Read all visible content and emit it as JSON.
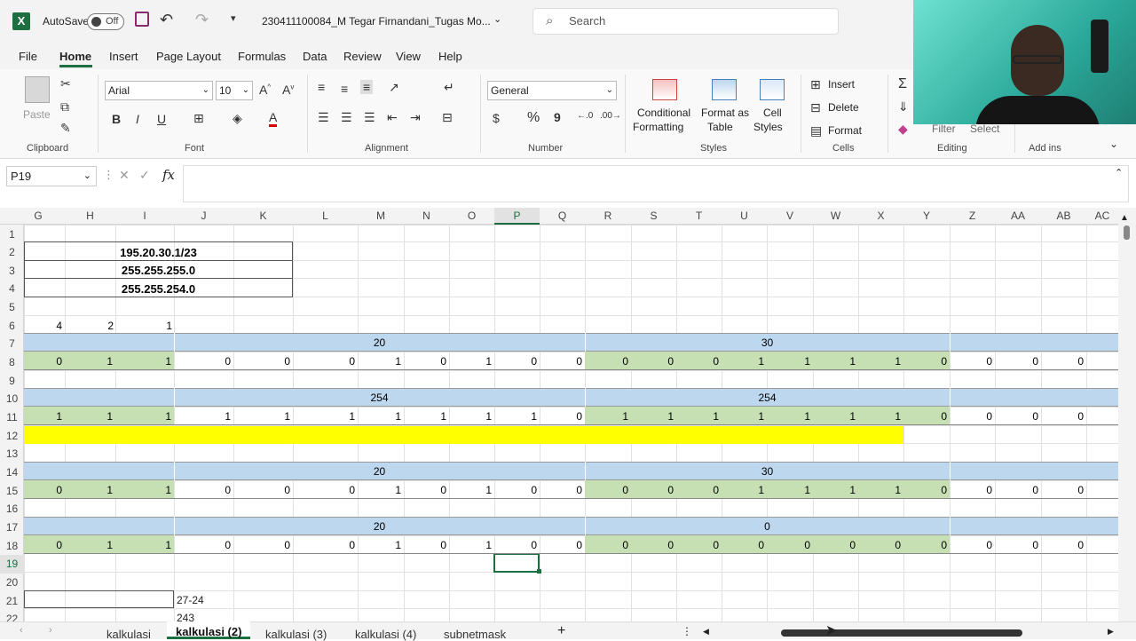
{
  "title_bar": {
    "autosave_label": "AutoSave",
    "autosave_state": "Off",
    "file_name": "230411100084_M Tegar Firnandani_Tugas Mo...",
    "search_placeholder": "Search"
  },
  "menu": [
    "File",
    "Home",
    "Insert",
    "Page Layout",
    "Formulas",
    "Data",
    "Review",
    "View",
    "Help"
  ],
  "ribbon": {
    "clipboard": {
      "paste": "Paste",
      "label": "Clipboard"
    },
    "font": {
      "name": "Arial",
      "size": "10",
      "bold": "B",
      "italic": "I",
      "underline": "U",
      "label": "Font"
    },
    "alignment": {
      "label": "Alignment"
    },
    "number": {
      "format": "General",
      "percent": "%",
      "comma": "9",
      "label": "Number"
    },
    "styles": {
      "conditional_1": "Conditional",
      "conditional_2": "Formatting",
      "table_1": "Format as",
      "table_2": "Table",
      "cell_1": "Cell",
      "cell_2": "Styles",
      "label": "Styles"
    },
    "cells": {
      "insert": "Insert",
      "delete": "Delete",
      "format": "Format",
      "label": "Cells"
    },
    "editing": {
      "filter": "Filter",
      "select": "Select",
      "label": "Editing"
    },
    "addins": {
      "label": "Add ins"
    }
  },
  "formula_bar": {
    "name_box": "P19",
    "fx": "fx",
    "content": ""
  },
  "columns": [
    "G",
    "H",
    "I",
    "J",
    "K",
    "L",
    "M",
    "N",
    "O",
    "P",
    "Q",
    "R",
    "S",
    "T",
    "U",
    "V",
    "W",
    "X",
    "Y",
    "Z",
    "AA",
    "AB",
    "AC"
  ],
  "rows": [
    "1",
    "2",
    "3",
    "4",
    "5",
    "6",
    "7",
    "8",
    "9",
    "10",
    "11",
    "12",
    "13",
    "14",
    "15",
    "16",
    "17",
    "18",
    "19",
    "20",
    "21",
    "22"
  ],
  "selected": {
    "column": "P",
    "row": "19"
  },
  "cells": {
    "ip": "195.20.30.1/23",
    "mask1": "255.255.255.0",
    "mask2": "255.255.254.0",
    "row6": [
      "4",
      "2",
      "1"
    ],
    "row7": {
      "a": "20",
      "b": "30"
    },
    "row8": [
      "0",
      "1",
      "1",
      "0",
      "0",
      "0",
      "1",
      "0",
      "1",
      "0",
      "0",
      "0",
      "0",
      "0",
      "1",
      "1",
      "1",
      "1",
      "0",
      "0",
      "0",
      "0"
    ],
    "row10": {
      "a": "254",
      "b": "254"
    },
    "row11": [
      "1",
      "1",
      "1",
      "1",
      "1",
      "1",
      "1",
      "1",
      "1",
      "1",
      "0",
      "1",
      "1",
      "1",
      "1",
      "1",
      "1",
      "1",
      "0",
      "0",
      "0",
      "0"
    ],
    "row14": {
      "a": "20",
      "b": "30"
    },
    "row15": [
      "0",
      "1",
      "1",
      "0",
      "0",
      "0",
      "1",
      "0",
      "1",
      "0",
      "0",
      "0",
      "0",
      "0",
      "1",
      "1",
      "1",
      "1",
      "0",
      "0",
      "0",
      "0"
    ],
    "row17": {
      "a": "20",
      "b": "0"
    },
    "row18": [
      "0",
      "1",
      "1",
      "0",
      "0",
      "0",
      "1",
      "0",
      "1",
      "0",
      "0",
      "0",
      "0",
      "0",
      "0",
      "0",
      "0",
      "0",
      "0",
      "0",
      "0",
      "0"
    ],
    "j21": "27-24",
    "j22": "243"
  },
  "sheet_tabs": [
    "kalkulasi",
    "kalkulasi (2)",
    "kalkulasi (3)",
    "kalkulasi (4)",
    "subnetmask"
  ],
  "active_tab": "kalkulasi (2)",
  "colors": {
    "excel_green": "#1d6f42",
    "band_blue": "#bdd7ee",
    "band_green": "#c6e0b4",
    "highlight_yellow": "#ffff00"
  }
}
